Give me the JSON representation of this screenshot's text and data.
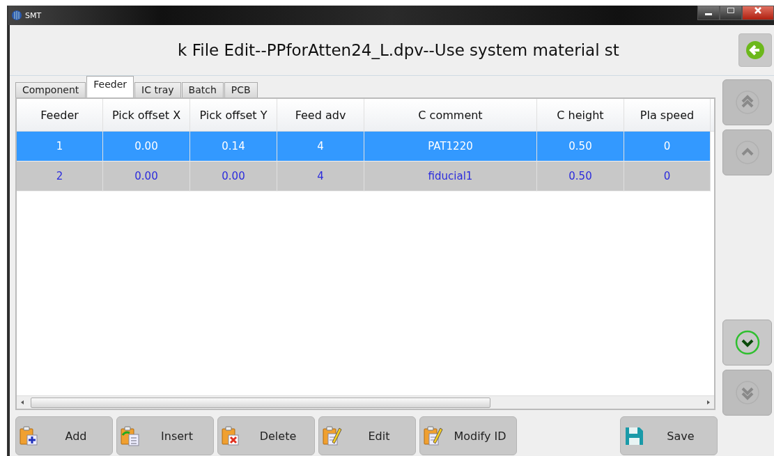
{
  "window": {
    "title": "SMT"
  },
  "header": {
    "title": "k File Edit--PPforAtten24_L.dpv--Use system material st"
  },
  "tabs": [
    {
      "label": "Component",
      "selected": false
    },
    {
      "label": "Feeder",
      "selected": true
    },
    {
      "label": "IC tray",
      "selected": false
    },
    {
      "label": "Batch",
      "selected": false
    },
    {
      "label": "PCB",
      "selected": false
    }
  ],
  "table": {
    "columns": [
      "Feeder",
      "Pick offset X",
      "Pick offset Y",
      "Feed adv",
      "C comment",
      "C height",
      "Pla speed"
    ],
    "rows": [
      {
        "selected": true,
        "cells": [
          "1",
          "0.00",
          "0.14",
          "4",
          "PAT1220",
          "0.50",
          "0"
        ]
      },
      {
        "selected": false,
        "cells": [
          "2",
          "0.00",
          "0.00",
          "4",
          "fiducial1",
          "0.50",
          "0"
        ]
      }
    ]
  },
  "nav_buttons": [
    {
      "kind": "first",
      "disabled": true
    },
    {
      "kind": "up",
      "disabled": true
    },
    {
      "kind": "down",
      "disabled": false
    },
    {
      "kind": "last",
      "disabled": true
    }
  ],
  "buttons": [
    {
      "kind": "add",
      "label": "Add"
    },
    {
      "kind": "insert",
      "label": "Insert"
    },
    {
      "kind": "delete",
      "label": "Delete"
    },
    {
      "kind": "edit",
      "label": "Edit"
    },
    {
      "kind": "edit",
      "label": "Modify ID"
    },
    {
      "kind": "save",
      "label": "Save"
    }
  ]
}
